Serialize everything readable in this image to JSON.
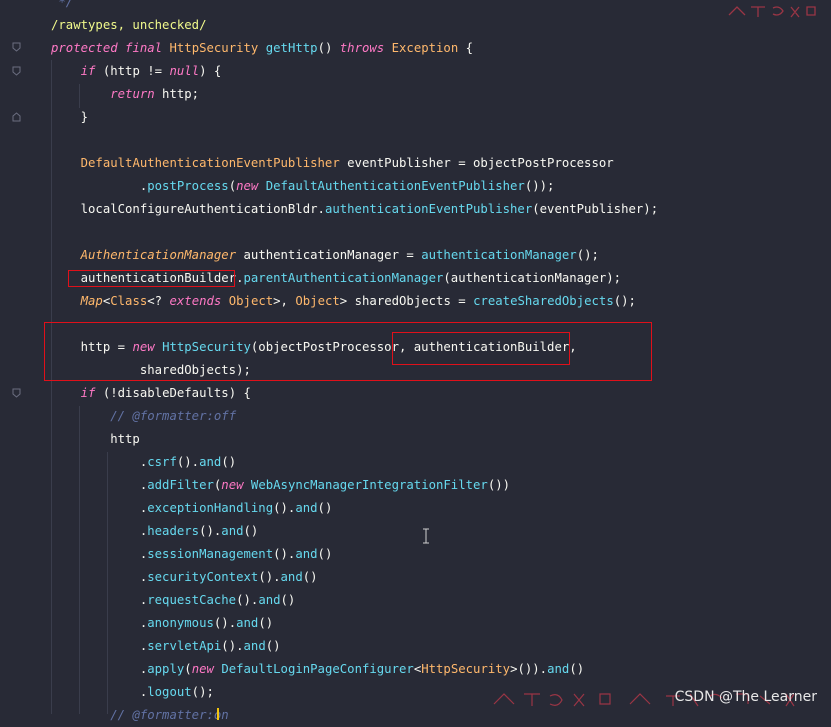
{
  "editor": {
    "lines": [
      {
        "tokens": [
          {
            "t": " */",
            "c": "cm"
          }
        ]
      },
      {
        "tokens": [
          {
            "t": "/rawtypes, unchecked/",
            "c": "an"
          }
        ]
      },
      {
        "tokens": [
          {
            "t": "protected",
            "c": "kw"
          },
          {
            "t": " ",
            "c": "pu"
          },
          {
            "t": "final",
            "c": "kw"
          },
          {
            "t": " ",
            "c": "pu"
          },
          {
            "t": "HttpSecurity",
            "c": "ty"
          },
          {
            "t": " ",
            "c": "pu"
          },
          {
            "t": "getHttp",
            "c": "fn"
          },
          {
            "t": "() ",
            "c": "pu"
          },
          {
            "t": "throws",
            "c": "kw"
          },
          {
            "t": " ",
            "c": "pu"
          },
          {
            "t": "Exception",
            "c": "ty"
          },
          {
            "t": " {",
            "c": "pu"
          }
        ]
      },
      {
        "tokens": [
          {
            "t": "    ",
            "c": "pu"
          },
          {
            "t": "if",
            "c": "kw"
          },
          {
            "t": " (http != ",
            "c": "pu"
          },
          {
            "t": "null",
            "c": "kw"
          },
          {
            "t": ") {",
            "c": "pu"
          }
        ]
      },
      {
        "tokens": [
          {
            "t": "        ",
            "c": "pu"
          },
          {
            "t": "return",
            "c": "kw"
          },
          {
            "t": " http;",
            "c": "pu"
          }
        ]
      },
      {
        "tokens": [
          {
            "t": "    }",
            "c": "pu"
          }
        ]
      },
      {
        "tokens": []
      },
      {
        "tokens": [
          {
            "t": "    ",
            "c": "pu"
          },
          {
            "t": "DefaultAuthenticationEventPublisher",
            "c": "ty"
          },
          {
            "t": " eventPublisher = objectPostProcessor",
            "c": "pu"
          }
        ]
      },
      {
        "tokens": [
          {
            "t": "            .",
            "c": "pu"
          },
          {
            "t": "postProcess",
            "c": "fn"
          },
          {
            "t": "(",
            "c": "pu"
          },
          {
            "t": "new",
            "c": "kw"
          },
          {
            "t": " ",
            "c": "pu"
          },
          {
            "t": "DefaultAuthenticationEventPublisher",
            "c": "fn"
          },
          {
            "t": "());",
            "c": "pu"
          }
        ]
      },
      {
        "tokens": [
          {
            "t": "    localConfigureAuthenticationBldr.",
            "c": "pu"
          },
          {
            "t": "authenticationEventPublisher",
            "c": "fn"
          },
          {
            "t": "(eventPublisher);",
            "c": "pu"
          }
        ]
      },
      {
        "tokens": []
      },
      {
        "tokens": [
          {
            "t": "    ",
            "c": "pu"
          },
          {
            "t": "AuthenticationManager",
            "c": "ti"
          },
          {
            "t": " authenticationManager = ",
            "c": "pu"
          },
          {
            "t": "authenticationManager",
            "c": "fn"
          },
          {
            "t": "();",
            "c": "pu"
          }
        ]
      },
      {
        "tokens": [
          {
            "t": "    authenticationBuilder.",
            "c": "pu"
          },
          {
            "t": "parentAuthenticationManager",
            "c": "fn"
          },
          {
            "t": "(authenticationManager);",
            "c": "pu"
          }
        ]
      },
      {
        "tokens": [
          {
            "t": "    ",
            "c": "pu"
          },
          {
            "t": "Map",
            "c": "ti"
          },
          {
            "t": "<",
            "c": "pu"
          },
          {
            "t": "Class",
            "c": "ty"
          },
          {
            "t": "<? ",
            "c": "pu"
          },
          {
            "t": "extends",
            "c": "kw"
          },
          {
            "t": " ",
            "c": "pu"
          },
          {
            "t": "Object",
            "c": "ty"
          },
          {
            "t": ">, ",
            "c": "pu"
          },
          {
            "t": "Object",
            "c": "ty"
          },
          {
            "t": "> sharedObjects = ",
            "c": "pu"
          },
          {
            "t": "createSharedObjects",
            "c": "fn"
          },
          {
            "t": "();",
            "c": "pu"
          }
        ]
      },
      {
        "tokens": []
      },
      {
        "tokens": [
          {
            "t": "    http = ",
            "c": "pu"
          },
          {
            "t": "new",
            "c": "kw"
          },
          {
            "t": " ",
            "c": "pu"
          },
          {
            "t": "HttpSecurity",
            "c": "fn"
          },
          {
            "t": "(objectPostProcessor, authenticationBuilder,",
            "c": "pu"
          }
        ]
      },
      {
        "tokens": [
          {
            "t": "            sharedObjects);",
            "c": "pu"
          }
        ]
      },
      {
        "tokens": [
          {
            "t": "    ",
            "c": "pu"
          },
          {
            "t": "if",
            "c": "kw"
          },
          {
            "t": " (!disableDefaults) {",
            "c": "pu"
          }
        ]
      },
      {
        "tokens": [
          {
            "t": "        ",
            "c": "pu"
          },
          {
            "t": "// @formatter:off",
            "c": "cm"
          }
        ]
      },
      {
        "tokens": [
          {
            "t": "        http",
            "c": "pu"
          }
        ]
      },
      {
        "tokens": [
          {
            "t": "            .",
            "c": "pu"
          },
          {
            "t": "csrf",
            "c": "fn"
          },
          {
            "t": "().",
            "c": "pu"
          },
          {
            "t": "and",
            "c": "fn"
          },
          {
            "t": "()",
            "c": "pu"
          }
        ]
      },
      {
        "tokens": [
          {
            "t": "            .",
            "c": "pu"
          },
          {
            "t": "addFilter",
            "c": "fn"
          },
          {
            "t": "(",
            "c": "pu"
          },
          {
            "t": "new",
            "c": "kw"
          },
          {
            "t": " ",
            "c": "pu"
          },
          {
            "t": "WebAsyncManagerIntegrationFilter",
            "c": "fn"
          },
          {
            "t": "())",
            "c": "pu"
          }
        ]
      },
      {
        "tokens": [
          {
            "t": "            .",
            "c": "pu"
          },
          {
            "t": "exceptionHandling",
            "c": "fn"
          },
          {
            "t": "().",
            "c": "pu"
          },
          {
            "t": "and",
            "c": "fn"
          },
          {
            "t": "()",
            "c": "pu"
          }
        ]
      },
      {
        "tokens": [
          {
            "t": "            .",
            "c": "pu"
          },
          {
            "t": "headers",
            "c": "fn"
          },
          {
            "t": "().",
            "c": "pu"
          },
          {
            "t": "and",
            "c": "fn"
          },
          {
            "t": "()",
            "c": "pu"
          }
        ]
      },
      {
        "tokens": [
          {
            "t": "            .",
            "c": "pu"
          },
          {
            "t": "sessionManagement",
            "c": "fn"
          },
          {
            "t": "().",
            "c": "pu"
          },
          {
            "t": "and",
            "c": "fn"
          },
          {
            "t": "()",
            "c": "pu"
          }
        ]
      },
      {
        "tokens": [
          {
            "t": "            .",
            "c": "pu"
          },
          {
            "t": "securityContext",
            "c": "fn"
          },
          {
            "t": "().",
            "c": "pu"
          },
          {
            "t": "and",
            "c": "fn"
          },
          {
            "t": "()",
            "c": "pu"
          }
        ]
      },
      {
        "tokens": [
          {
            "t": "            .",
            "c": "pu"
          },
          {
            "t": "requestCache",
            "c": "fn"
          },
          {
            "t": "().",
            "c": "pu"
          },
          {
            "t": "and",
            "c": "fn"
          },
          {
            "t": "()",
            "c": "pu"
          }
        ]
      },
      {
        "tokens": [
          {
            "t": "            .",
            "c": "pu"
          },
          {
            "t": "anonymous",
            "c": "fn"
          },
          {
            "t": "().",
            "c": "pu"
          },
          {
            "t": "and",
            "c": "fn"
          },
          {
            "t": "()",
            "c": "pu"
          }
        ]
      },
      {
        "tokens": [
          {
            "t": "            .",
            "c": "pu"
          },
          {
            "t": "servletApi",
            "c": "fn"
          },
          {
            "t": "().",
            "c": "pu"
          },
          {
            "t": "and",
            "c": "fn"
          },
          {
            "t": "()",
            "c": "pu"
          }
        ]
      },
      {
        "tokens": [
          {
            "t": "            .",
            "c": "pu"
          },
          {
            "t": "apply",
            "c": "fn"
          },
          {
            "t": "(",
            "c": "pu"
          },
          {
            "t": "new",
            "c": "kw"
          },
          {
            "t": " ",
            "c": "pu"
          },
          {
            "t": "DefaultLoginPageConfigurer",
            "c": "fn"
          },
          {
            "t": "<",
            "c": "pu"
          },
          {
            "t": "HttpSecurity",
            "c": "ty"
          },
          {
            "t": ">()).",
            "c": "pu"
          },
          {
            "t": "and",
            "c": "fn"
          },
          {
            "t": "()",
            "c": "pu"
          }
        ]
      },
      {
        "tokens": [
          {
            "t": "            .",
            "c": "pu"
          },
          {
            "t": "logout",
            "c": "fn"
          },
          {
            "t": "();",
            "c": "pu"
          }
        ]
      },
      {
        "tokens": [
          {
            "t": "        ",
            "c": "pu"
          },
          {
            "t": "// @formatter:on",
            "c": "cm"
          }
        ]
      }
    ]
  },
  "watermarks": {
    "csdn": "CSDN @The Learner"
  },
  "colors": {
    "background": "#282a36",
    "highlight_box": "#e0101a"
  }
}
